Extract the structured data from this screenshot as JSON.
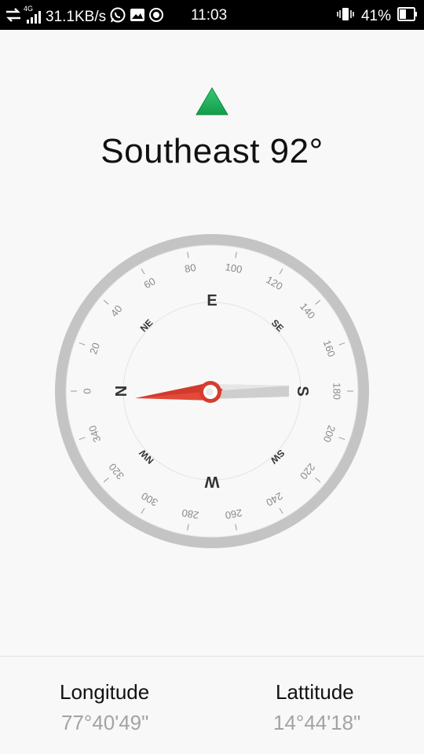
{
  "status_bar": {
    "network_badge": "4G",
    "speed": "31.1KB/s",
    "time": "11:03",
    "battery": "41%",
    "icons": [
      "data-transfer-icon",
      "signal-icon",
      "whatsapp-icon",
      "gallery-icon",
      "location-icon",
      "vibrate-icon",
      "battery-icon"
    ]
  },
  "compass": {
    "direction": "Southeast 92°",
    "indicator_color": "#1fb25a",
    "needle_color": "#e24a3b",
    "cardinals": [
      "E",
      "S",
      "W",
      "N"
    ],
    "intercardinals": [
      "SE",
      "SW",
      "NW",
      "NE"
    ],
    "degree_labels": [
      "0",
      "20",
      "40",
      "60",
      "80",
      "100",
      "120",
      "140",
      "160",
      "180",
      "200",
      "220",
      "240",
      "260",
      "280",
      "300",
      "320",
      "340"
    ]
  },
  "location": {
    "longitude_label": "Longitude",
    "longitude_value": "77°40'49\"",
    "latitude_label": "Lattitude",
    "latitude_value": "14°44'18\""
  }
}
